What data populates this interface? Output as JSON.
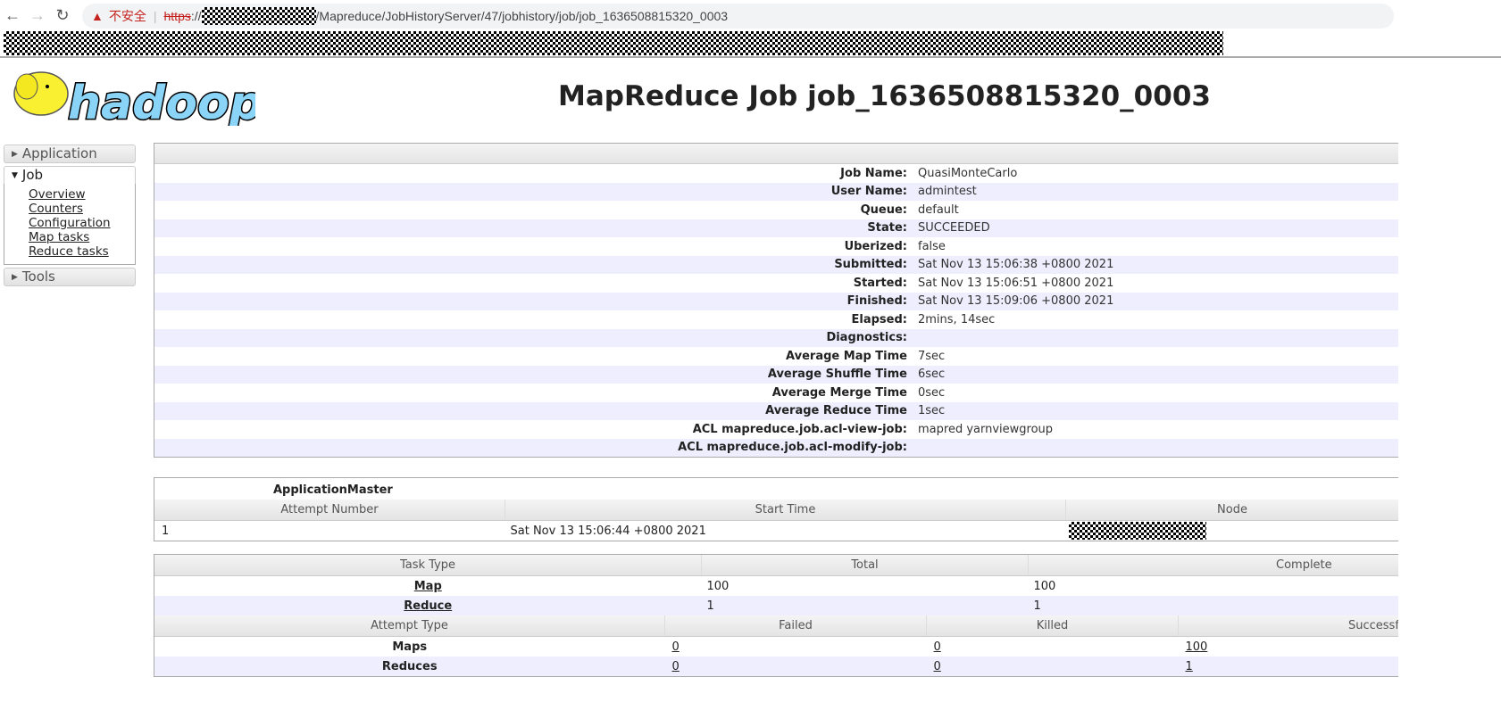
{
  "browser": {
    "insecure_label": "不安全",
    "url_scheme": "https",
    "url_path": "/Mapreduce/JobHistoryServer/47/jobhistory/job/job_1636508815320_0003"
  },
  "logo_text": "hadoop",
  "page_title": "MapReduce Job job_1636508815320_0003",
  "sidebar": {
    "application": "Application",
    "job": "Job",
    "job_items": [
      "Overview",
      "Counters",
      "Configuration",
      "Map tasks",
      "Reduce tasks"
    ],
    "tools": "Tools"
  },
  "job_info": [
    {
      "label": "Job Name:",
      "value": "QuasiMonteCarlo"
    },
    {
      "label": "User Name:",
      "value": "admintest"
    },
    {
      "label": "Queue:",
      "value": "default"
    },
    {
      "label": "State:",
      "value": "SUCCEEDED"
    },
    {
      "label": "Uberized:",
      "value": "false"
    },
    {
      "label": "Submitted:",
      "value": "Sat Nov 13 15:06:38 +0800 2021"
    },
    {
      "label": "Started:",
      "value": "Sat Nov 13 15:06:51 +0800 2021"
    },
    {
      "label": "Finished:",
      "value": "Sat Nov 13 15:09:06 +0800 2021"
    },
    {
      "label": "Elapsed:",
      "value": "2mins, 14sec"
    },
    {
      "label": "Diagnostics:",
      "value": ""
    },
    {
      "label": "Average Map Time",
      "value": "7sec"
    },
    {
      "label": "Average Shuffle Time",
      "value": "6sec"
    },
    {
      "label": "Average Merge Time",
      "value": "0sec"
    },
    {
      "label": "Average Reduce Time",
      "value": "1sec"
    },
    {
      "label": "ACL mapreduce.job.acl-view-job:",
      "value": "mapred yarnviewgroup"
    },
    {
      "label": "ACL mapreduce.job.acl-modify-job:",
      "value": ""
    }
  ],
  "am": {
    "title": "ApplicationMaster",
    "headers": [
      "Attempt Number",
      "Start Time",
      "Node"
    ],
    "rows": [
      {
        "attempt": "1",
        "start": "Sat Nov 13 15:06:44 +0800 2021"
      }
    ]
  },
  "tasks": {
    "headers": [
      "Task Type",
      "Total",
      "Complete"
    ],
    "rows": [
      {
        "type": "Map",
        "total": "100",
        "complete": "100"
      },
      {
        "type": "Reduce",
        "total": "1",
        "complete": "1"
      }
    ]
  },
  "attempts": {
    "headers": [
      "Attempt Type",
      "Failed",
      "Killed",
      "Successful"
    ],
    "rows": [
      {
        "type": "Maps",
        "failed": "0",
        "killed": "0",
        "successful": "100"
      },
      {
        "type": "Reduces",
        "failed": "0",
        "killed": "0",
        "successful": "1"
      }
    ]
  }
}
